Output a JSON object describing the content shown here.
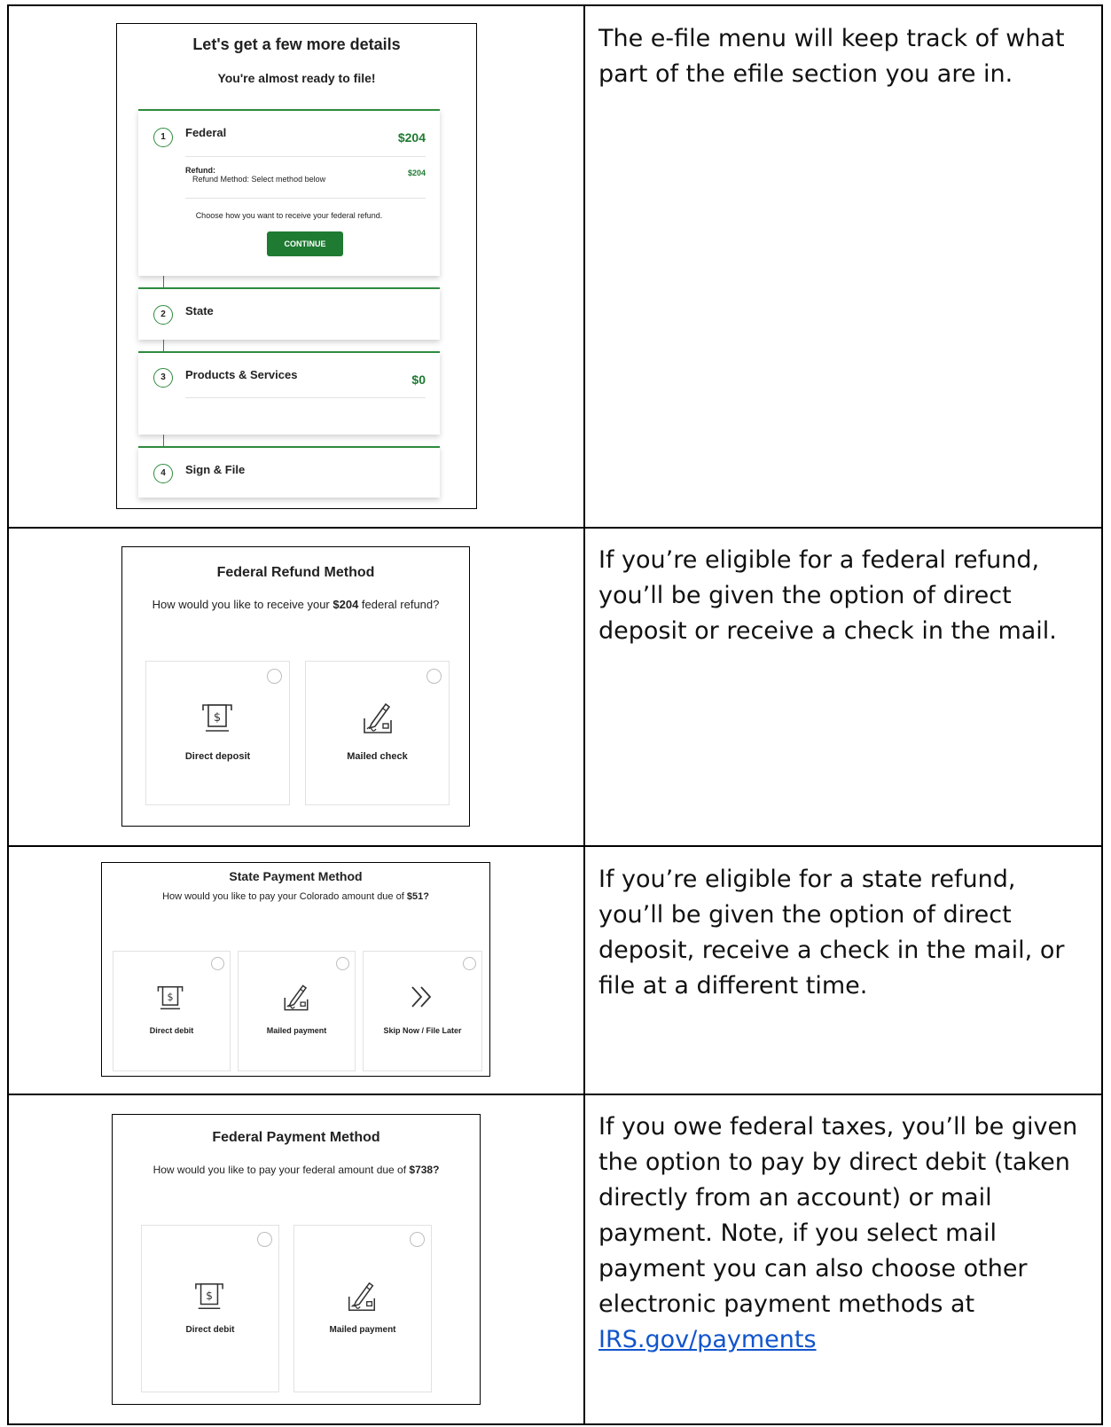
{
  "rows": [
    {
      "description": "The e-file menu will keep track of what part of the efile section you are in."
    },
    {
      "description": "If you’re eligible for a federal refund, you’ll be given the option of direct deposit or receive a check in the mail."
    },
    {
      "description": "If you’re eligible for a state refund, you’ll be given the option of direct deposit, receive a check in the mail, or file at a different time."
    },
    {
      "description_text": "If you owe federal taxes, you’ll be given the option to pay by direct debit (taken directly from an account) or mail payment. Note, if you select mail payment you can also choose other electronic payment methods at ",
      "link_text": "IRS.gov/payments"
    }
  ],
  "efile_menu": {
    "title": "Let's get a few more details",
    "subtitle": "You're almost ready to file!",
    "steps": [
      {
        "number": "1",
        "label": "Federal",
        "amount": "$204"
      },
      {
        "number": "2",
        "label": "State"
      },
      {
        "number": "3",
        "label": "Products & Services",
        "amount": "$0"
      },
      {
        "number": "4",
        "label": "Sign & File"
      }
    ],
    "refund_label": "Refund:",
    "refund_amount": "$204",
    "refund_method": "Refund Method: Select method below",
    "choose_text": "Choose how you want to receive your federal refund.",
    "continue_label": "CONTINUE",
    "accent_color": "#1f7a32"
  },
  "federal_refund": {
    "title": "Federal Refund Method",
    "question_prefix": "How would you like to receive your ",
    "question_amount": "$204",
    "question_suffix": " federal refund?",
    "options": [
      "Direct deposit",
      "Mailed check"
    ]
  },
  "state_payment": {
    "title": "State Payment Method",
    "question_prefix": "How would you like to pay your Colorado amount due of ",
    "question_amount": "$51?",
    "options": [
      "Direct debit",
      "Mailed payment",
      "Skip Now / File Later"
    ]
  },
  "federal_payment": {
    "title": "Federal Payment Method",
    "question_prefix": "How would you like to pay your federal amount due of ",
    "question_amount": "$738?",
    "options": [
      "Direct debit",
      "Mailed payment"
    ]
  },
  "icons": [
    "atm-dollar-icon",
    "signed-check-icon",
    "double-chevron-right-icon"
  ]
}
